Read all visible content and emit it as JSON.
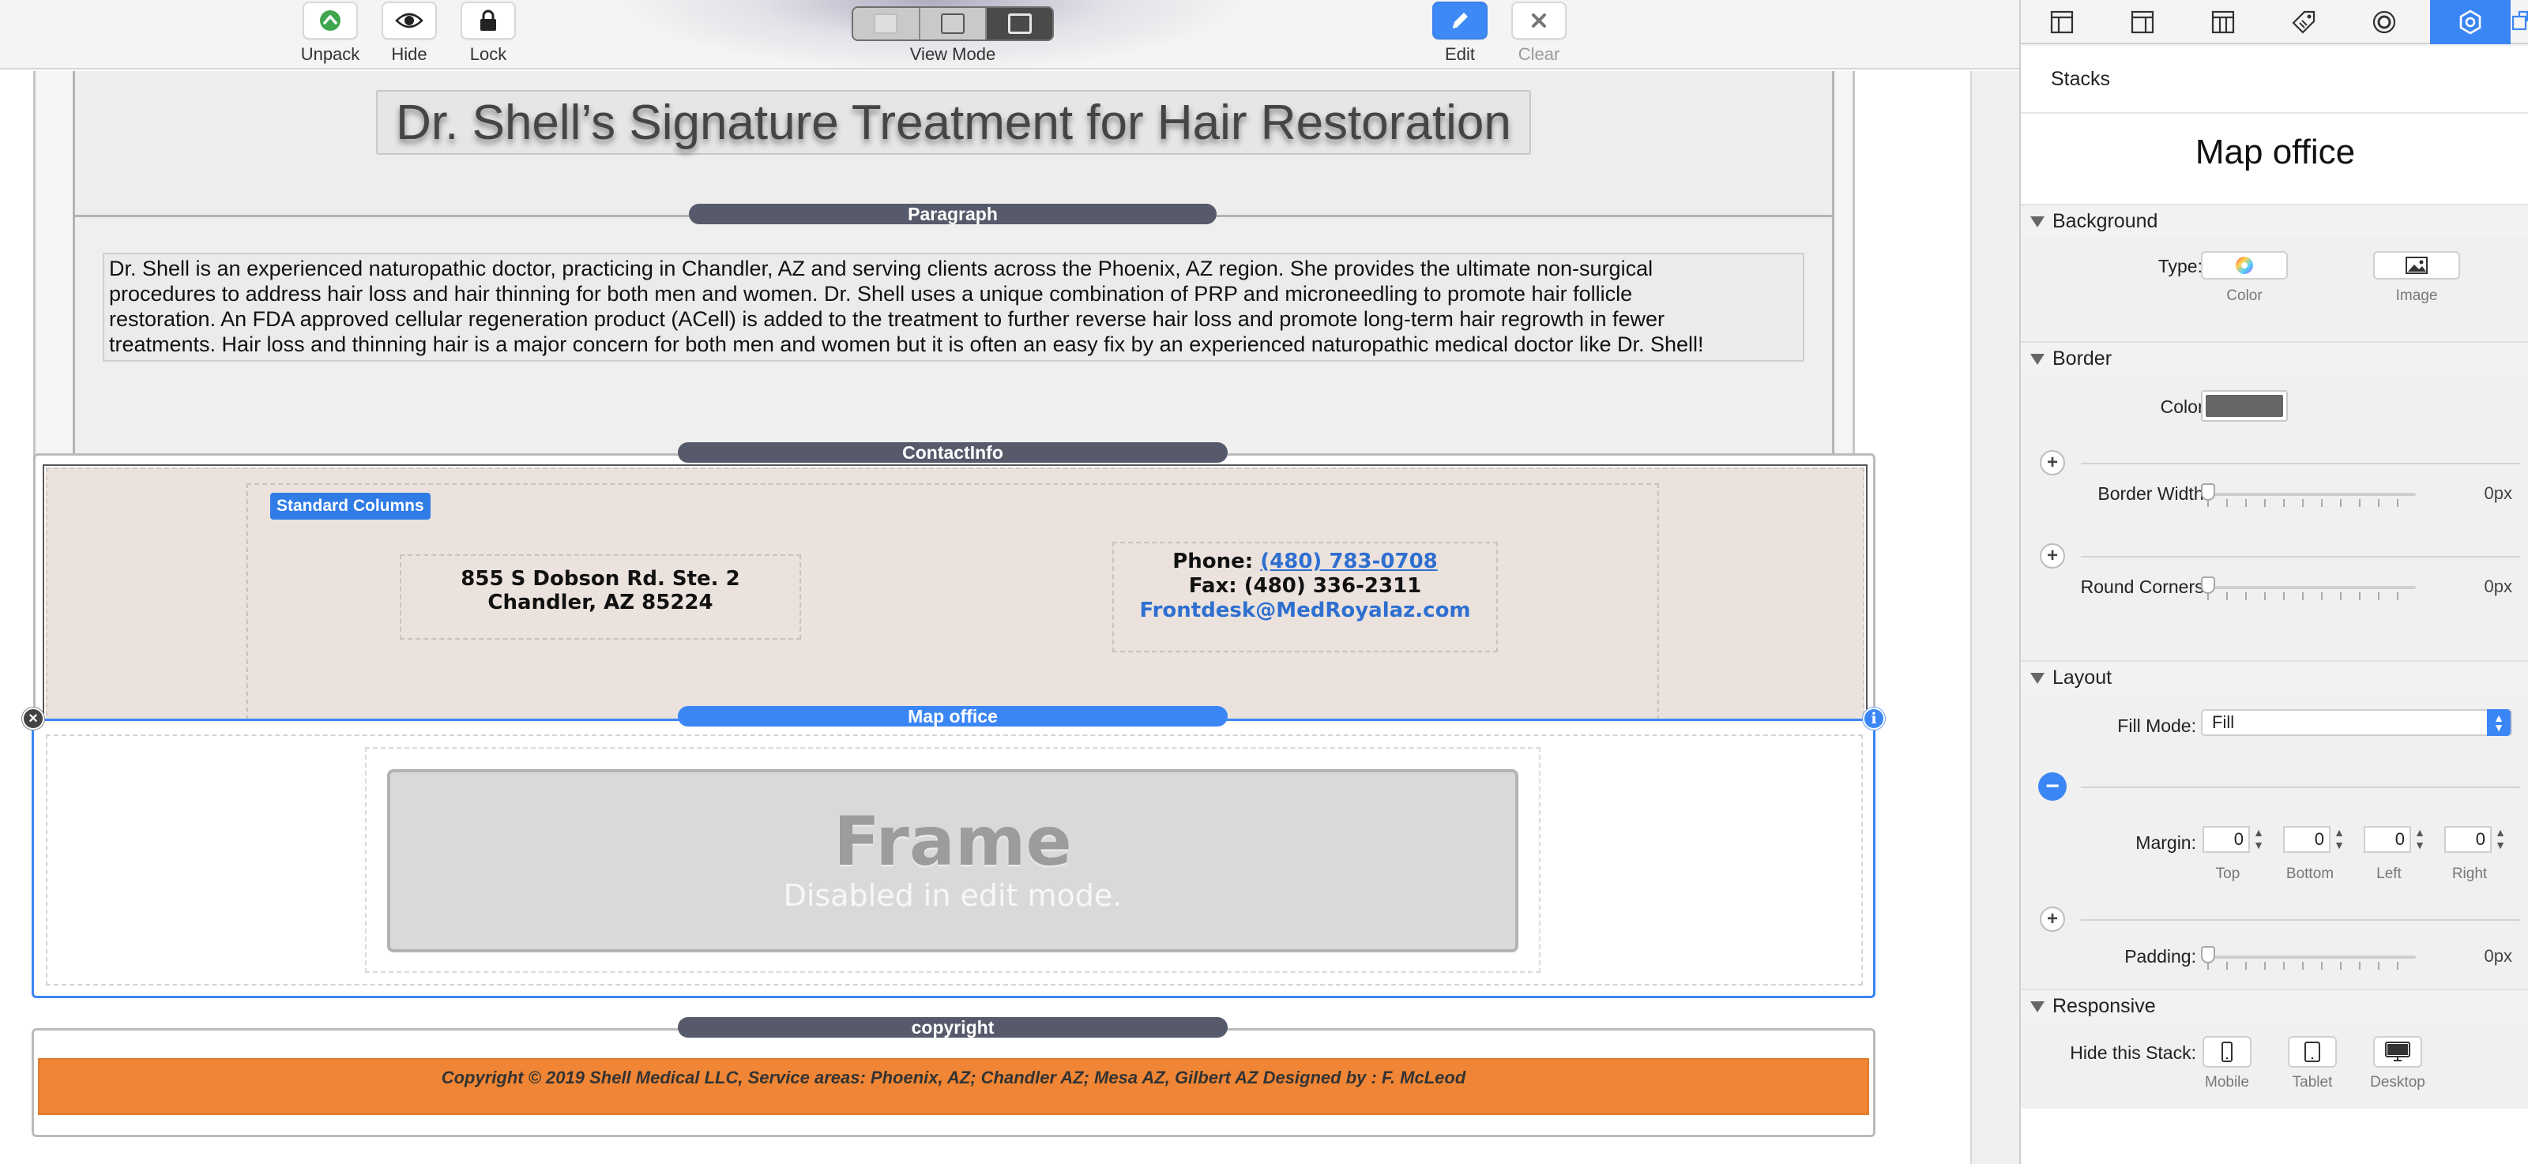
{
  "toolbar": {
    "unpack": "Unpack",
    "hide": "Hide",
    "lock": "Lock",
    "view_mode": "View Mode",
    "edit": "Edit",
    "clear": "Clear"
  },
  "canvas": {
    "title_stack": {
      "heading": "Dr. Shell’s Signature Treatment for Hair Restoration"
    },
    "paragraph_stack": {
      "label": "Paragraph",
      "lines": [
        "Dr. Shell is an experienced naturopathic doctor, practicing in Chandler, AZ and serving clients across the Phoenix, AZ region. She provides the ultimate non-surgical",
        "procedures to address hair loss and hair thinning for both men and women. Dr. Shell uses a unique combination of PRP and microneedling to promote hair follicle",
        "restoration. An FDA approved cellular regeneration product (ACell) is added to the treatment to further reverse hair loss and promote long-term hair regrowth in fewer",
        "treatments. Hair loss and thinning hair is a major concern for both men and women but it is often an easy fix by an experienced naturopathic medical doctor like Dr. Shell!"
      ]
    },
    "contact_stack": {
      "label": "ContactInfo",
      "columns_badge": "Standard Columns",
      "address_line1": "855 S Dobson Rd. Ste. 2",
      "address_line2": "Chandler, AZ 85224",
      "phone_label": "Phone:",
      "phone_number": "(480) 783-0708",
      "fax": "Fax: (480) 336-2311",
      "email": "Frontdesk@MedRoyalaz.com"
    },
    "map_stack": {
      "label": "Map office",
      "frame_title": "Frame",
      "frame_subtitle": "Disabled in edit mode."
    },
    "copyright_stack": {
      "label": "copyright",
      "text": "Copyright © 2019 Shell Medical LLC, Service areas: Phoenix, AZ; Chandler AZ; Mesa AZ, Gilbert AZ Designed by : F. McLeod"
    }
  },
  "inspector": {
    "header": "Stacks",
    "title": "Map office",
    "background": {
      "section": "Background",
      "type_label": "Type:",
      "color_option": "Color",
      "image_option": "Image"
    },
    "border": {
      "section": "Border",
      "color_label": "Color:",
      "color_value": "#666666",
      "width_label": "Border Width:",
      "width_value": "0px",
      "corners_label": "Round Corners:",
      "corners_value": "0px"
    },
    "layout": {
      "section": "Layout",
      "fill_mode_label": "Fill Mode:",
      "fill_mode_value": "Fill",
      "margin_label": "Margin:",
      "margin_top": "0",
      "margin_bottom": "0",
      "margin_left": "0",
      "margin_right": "0",
      "top_label": "Top",
      "bottom_label": "Bottom",
      "left_label": "Left",
      "right_label": "Right",
      "padding_label": "Padding:",
      "padding_value": "0px"
    },
    "responsive": {
      "section": "Responsive",
      "hide_label": "Hide this Stack:",
      "mobile": "Mobile",
      "tablet": "Tablet",
      "desktop": "Desktop"
    }
  },
  "colors": {
    "accent": "#3b86f5",
    "pill": "#565a6b",
    "copyright_bar": "#f08635",
    "contact_bg": "#ebe2dd"
  }
}
